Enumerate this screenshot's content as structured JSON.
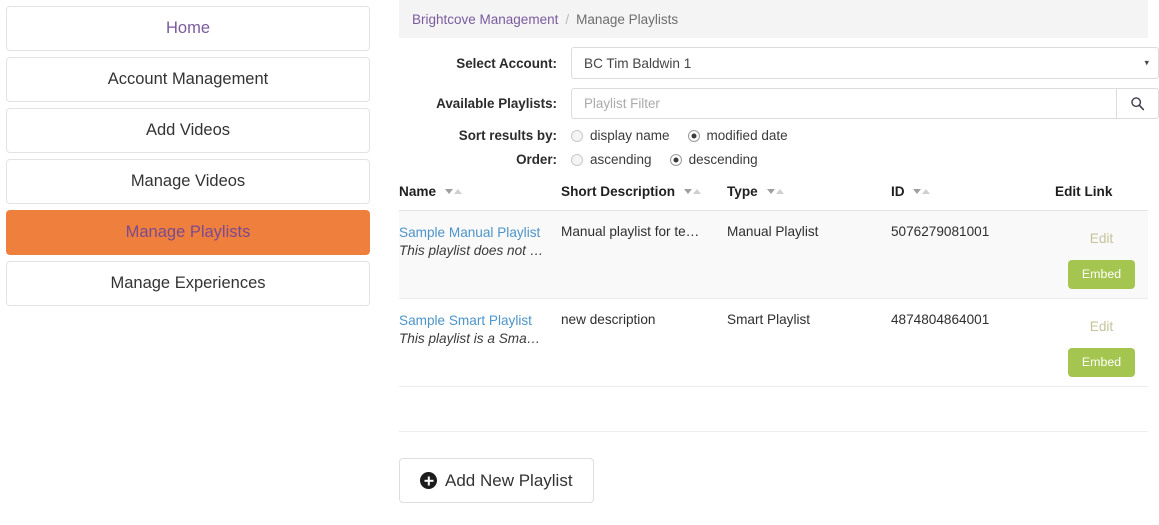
{
  "sidebar": {
    "items": [
      {
        "label": "Home",
        "active": false,
        "visited": true
      },
      {
        "label": "Account Management",
        "active": false,
        "visited": false
      },
      {
        "label": "Add Videos",
        "active": false,
        "visited": false
      },
      {
        "label": "Manage Videos",
        "active": false,
        "visited": false
      },
      {
        "label": "Manage Playlists",
        "active": true,
        "visited": true
      },
      {
        "label": "Manage Experiences",
        "active": false,
        "visited": false
      }
    ]
  },
  "breadcrumb": {
    "root": "Brightcove Management",
    "separator": "/",
    "current": "Manage Playlists"
  },
  "form": {
    "account": {
      "label": "Select Account:",
      "value": "BC Tim Baldwin 1",
      "caret": "▾"
    },
    "playlists": {
      "label": "Available Playlists:",
      "placeholder": "Playlist Filter",
      "value": "",
      "search_icon": "search-icon"
    },
    "sort": {
      "label": "Sort results by:",
      "options": [
        {
          "label": "display name",
          "checked": false
        },
        {
          "label": "modified date",
          "checked": true
        }
      ]
    },
    "order": {
      "label": "Order:",
      "options": [
        {
          "label": "ascending",
          "checked": false
        },
        {
          "label": "descending",
          "checked": true
        }
      ]
    }
  },
  "table": {
    "columns": [
      {
        "label": "Name",
        "sortable": true
      },
      {
        "label": "Short Description",
        "sortable": true
      },
      {
        "label": "Type",
        "sortable": true
      },
      {
        "label": "ID",
        "sortable": true
      },
      {
        "label": "Edit Link",
        "sortable": false
      }
    ],
    "rows": [
      {
        "name": "Sample Manual Playlist",
        "subtitle": "This playlist does not …",
        "description": "Manual playlist for te…",
        "type": "Manual Playlist",
        "id": "5076279081001",
        "edit_label": "Edit",
        "embed_label": "Embed"
      },
      {
        "name": "Sample Smart Playlist",
        "subtitle": "This playlist is a Sma…",
        "description": "new description",
        "type": "Smart Playlist",
        "id": "4874804864001",
        "edit_label": "Edit",
        "embed_label": "Embed"
      }
    ]
  },
  "actions": {
    "add_playlist": "Add New Playlist",
    "add_icon": "plus-circle-icon"
  },
  "colors": {
    "accent_orange": "#ef7f3c",
    "link_purple": "#7a5b9e",
    "link_blue": "#4d94c8",
    "embed_green": "#a4c550",
    "edit_khaki": "#c6c39a",
    "breadcrumb_bg": "#f4f4f5"
  }
}
